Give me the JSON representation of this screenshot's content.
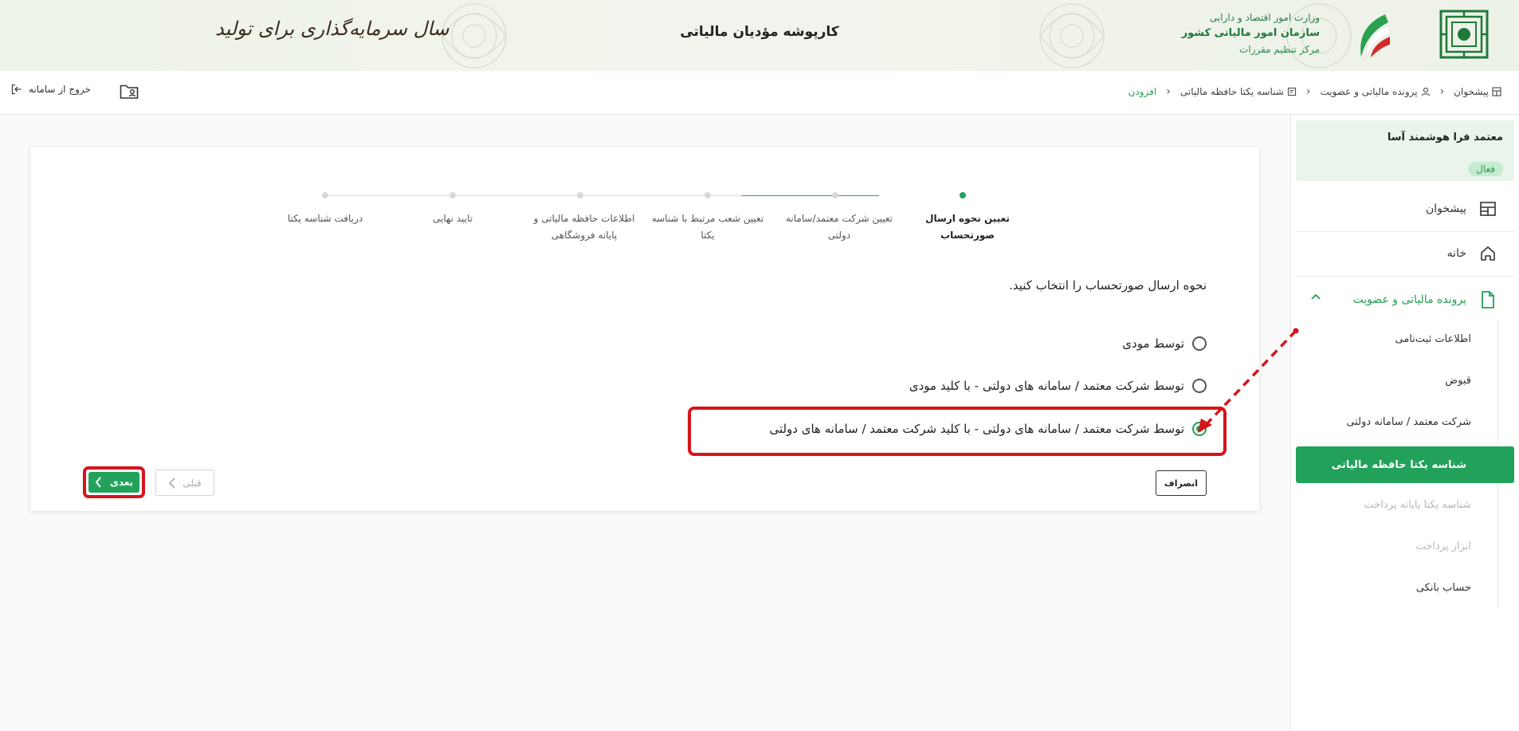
{
  "header": {
    "title": "کارپوشه مؤدیان مالیاتی",
    "slogan": "سال سرمایه‌گذاری برای تولید",
    "org_line1": "وزارت امور اقتصاد و دارایی",
    "org_line2": "سازمان امور مالیاتی کشور",
    "org_line3": "مرکز تنظیم مقررات"
  },
  "topbar": {
    "breadcrumb": [
      "پیشخوان",
      "پرونده مالیاتی و عضویت",
      "شناسه یکتا حافظه مالیاتی",
      "افزودن"
    ],
    "logout_label": "خروج از سامانه"
  },
  "sidebar": {
    "user_name": "معتمد فرا هوشمند آسا",
    "status_badge": "فعال",
    "items": [
      {
        "label": "پیشخوان",
        "icon": "dashboard-icon"
      },
      {
        "label": "خانه",
        "icon": "home-icon"
      },
      {
        "label": "پرونده مالیاتی و عضویت",
        "icon": "document-icon"
      }
    ],
    "sub_items": [
      {
        "label": "اطلاعات ثبت‌نامی",
        "state": "normal"
      },
      {
        "label": "قبوض",
        "state": "normal"
      },
      {
        "label": "شرکت معتمد / سامانه دولتی",
        "state": "normal"
      },
      {
        "label": "شناسه یکتا حافظه مالیاتی",
        "state": "active"
      },
      {
        "label": "شناسه یکتا پایانه پرداخت",
        "state": "disabled"
      },
      {
        "label": "ابزار پرداخت",
        "state": "disabled"
      },
      {
        "label": "حساب بانکی",
        "state": "normal"
      }
    ]
  },
  "stepper": {
    "steps": [
      {
        "line1": "تعیین نحوه ارسال",
        "line2": "صورتحساب",
        "state": "active"
      },
      {
        "line1": "تعیین شرکت معتمد/سامانه",
        "line2": "دولتی",
        "state": "pending"
      },
      {
        "line1": "تعیین شعب مرتبط با شناسه",
        "line2": "یکتا",
        "state": "pending"
      },
      {
        "line1": "اطلاعات حافظه مالیاتی و",
        "line2": "پایانه فروشگاهی",
        "state": "pending"
      },
      {
        "line1": "تایید نهایی",
        "line2": "",
        "state": "pending"
      },
      {
        "line1": "دریافت شناسه یکتا",
        "line2": "",
        "state": "pending"
      }
    ]
  },
  "form": {
    "question": "نحوه ارسال صورتحساب را انتخاب کنید.",
    "options": [
      {
        "label": "توسط مودی",
        "checked": false
      },
      {
        "label": "توسط شرکت معتمد / سامانه های دولتی - با کلید مودی",
        "checked": false
      },
      {
        "label": "توسط شرکت معتمد / سامانه های دولتی - با کلید شرکت معتمد / سامانه های دولتی",
        "checked": true
      }
    ],
    "cancel_label": "انصراف",
    "prev_label": "قبلی",
    "next_label": "بعدی"
  },
  "colors": {
    "accent": "#22a15a",
    "highlight": "#d6151b"
  }
}
